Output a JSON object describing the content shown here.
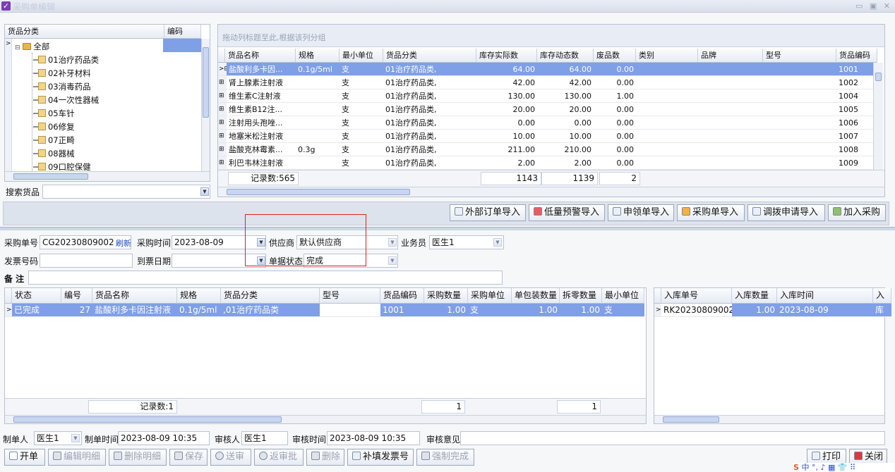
{
  "window": {
    "title": "采购单编辑"
  },
  "category_tree": {
    "col_category": "货品分类",
    "col_code": "编码",
    "nodes": [
      "全部",
      "01治疗药品类",
      "02补牙材料",
      "03消毒药品",
      "04一次性器械",
      "05车针",
      "06修复",
      "07正畸",
      "08器械",
      "09口腔保健"
    ]
  },
  "search": {
    "label": "搜索货品",
    "value": ""
  },
  "goods_grid": {
    "group_hint": "拖动列标题至此,根据该列分组",
    "columns": [
      "货品名称",
      "规格",
      "最小单位",
      "货品分类",
      "库存实际数",
      "库存动态数",
      "废品数",
      "类别",
      "品牌",
      "型号",
      "货品编码"
    ],
    "rows": [
      [
        "盐酸利多卡因...",
        "0.1g/5ml",
        "支",
        "01治疗药品类,",
        "64.00",
        "64.00",
        "0.00",
        "",
        "",
        "",
        "1001"
      ],
      [
        "肾上腺素注射液",
        "",
        "支",
        "01治疗药品类,",
        "42.00",
        "42.00",
        "0.00",
        "",
        "",
        "",
        "1002"
      ],
      [
        "维生素C注射液",
        "",
        "支",
        "01治疗药品类,",
        "130.00",
        "130.00",
        "1.00",
        "",
        "",
        "",
        "1004"
      ],
      [
        "维生素B12注...",
        "",
        "支",
        "01治疗药品类,",
        "20.00",
        "20.00",
        "0.00",
        "",
        "",
        "",
        "1005"
      ],
      [
        "注射用头孢唑...",
        "",
        "支",
        "01治疗药品类,",
        "0.00",
        "0.00",
        "0.00",
        "",
        "",
        "",
        "1006"
      ],
      [
        "地塞米松注射液",
        "",
        "支",
        "01治疗药品类,",
        "10.00",
        "10.00",
        "0.00",
        "",
        "",
        "",
        "1007"
      ],
      [
        "盐酸克林霉素...",
        "0.3g",
        "支",
        "01治疗药品类,",
        "211.00",
        "210.00",
        "0.00",
        "",
        "",
        "",
        "1008"
      ],
      [
        "利巴韦林注射液",
        "",
        "支",
        "01治疗药品类,",
        "2.00",
        "2.00",
        "0.00",
        "",
        "",
        "",
        "1009"
      ]
    ],
    "footer": {
      "count": "记录数:565",
      "actual_sum": "1143",
      "dynamic_sum": "1139",
      "waste_sum": "2"
    }
  },
  "import_buttons": [
    "外部订单导入",
    "低量预警导入",
    "申领单导入",
    "采购单导入",
    "调拨申请导入",
    "加入采购"
  ],
  "form": {
    "order_no_label": "采购单号",
    "order_no": "CG20230809002",
    "refresh": "刷新",
    "time_label": "采购时间",
    "time": "2023-08-09",
    "supplier_label": "供应商",
    "supplier": "默认供应商",
    "salesman_label": "业务员",
    "salesman": "医生1",
    "invoice_label": "发票号码",
    "invoice": "",
    "arrive_label": "到票日期",
    "arrive": "",
    "status_label": "单据状态",
    "status": "完成",
    "remark_label": "备  注",
    "remark": ""
  },
  "detail_grid": {
    "columns": [
      "状态",
      "编号",
      "货品名称",
      "规格",
      "货品分类",
      "型号",
      "货品编码",
      "采购数量",
      "采购单位",
      "单包装数量",
      "拆零数量",
      "最小单位"
    ],
    "row": [
      "已完成",
      "27",
      "盐酸利多卡因注射液",
      "0.1g/5ml",
      ",01治疗药品类",
      "",
      "1001",
      "1.00",
      "支",
      "1.00",
      "1.00",
      "支"
    ],
    "footer": {
      "count": "记录数:1",
      "qty_sum": "1",
      "split_sum": "1"
    }
  },
  "inbound_grid": {
    "columns": [
      "入库单号",
      "入库数量",
      "入库时间",
      "入"
    ],
    "row": [
      "RK20230809002",
      "1.00",
      "2023-08-09",
      "库"
    ]
  },
  "audit": {
    "maker_label": "制单人",
    "maker": "医生1",
    "make_time_label": "制单时间",
    "make_time": "2023-08-09 10:35",
    "auditor_label": "审核人",
    "auditor": "医生1",
    "audit_time_label": "审核时间",
    "audit_time": "2023-08-09 10:35",
    "opinion_label": "审核意见",
    "opinion": ""
  },
  "bottom_buttons": [
    "开单",
    "编辑明细",
    "删除明细",
    "保存",
    "送审",
    "返审批",
    "删除",
    "补填发票号",
    "强制完成"
  ],
  "right_buttons": [
    "打印",
    "关闭"
  ],
  "tray": [
    "中",
    "°,",
    "♪",
    "▦",
    "👕",
    "⠿"
  ]
}
